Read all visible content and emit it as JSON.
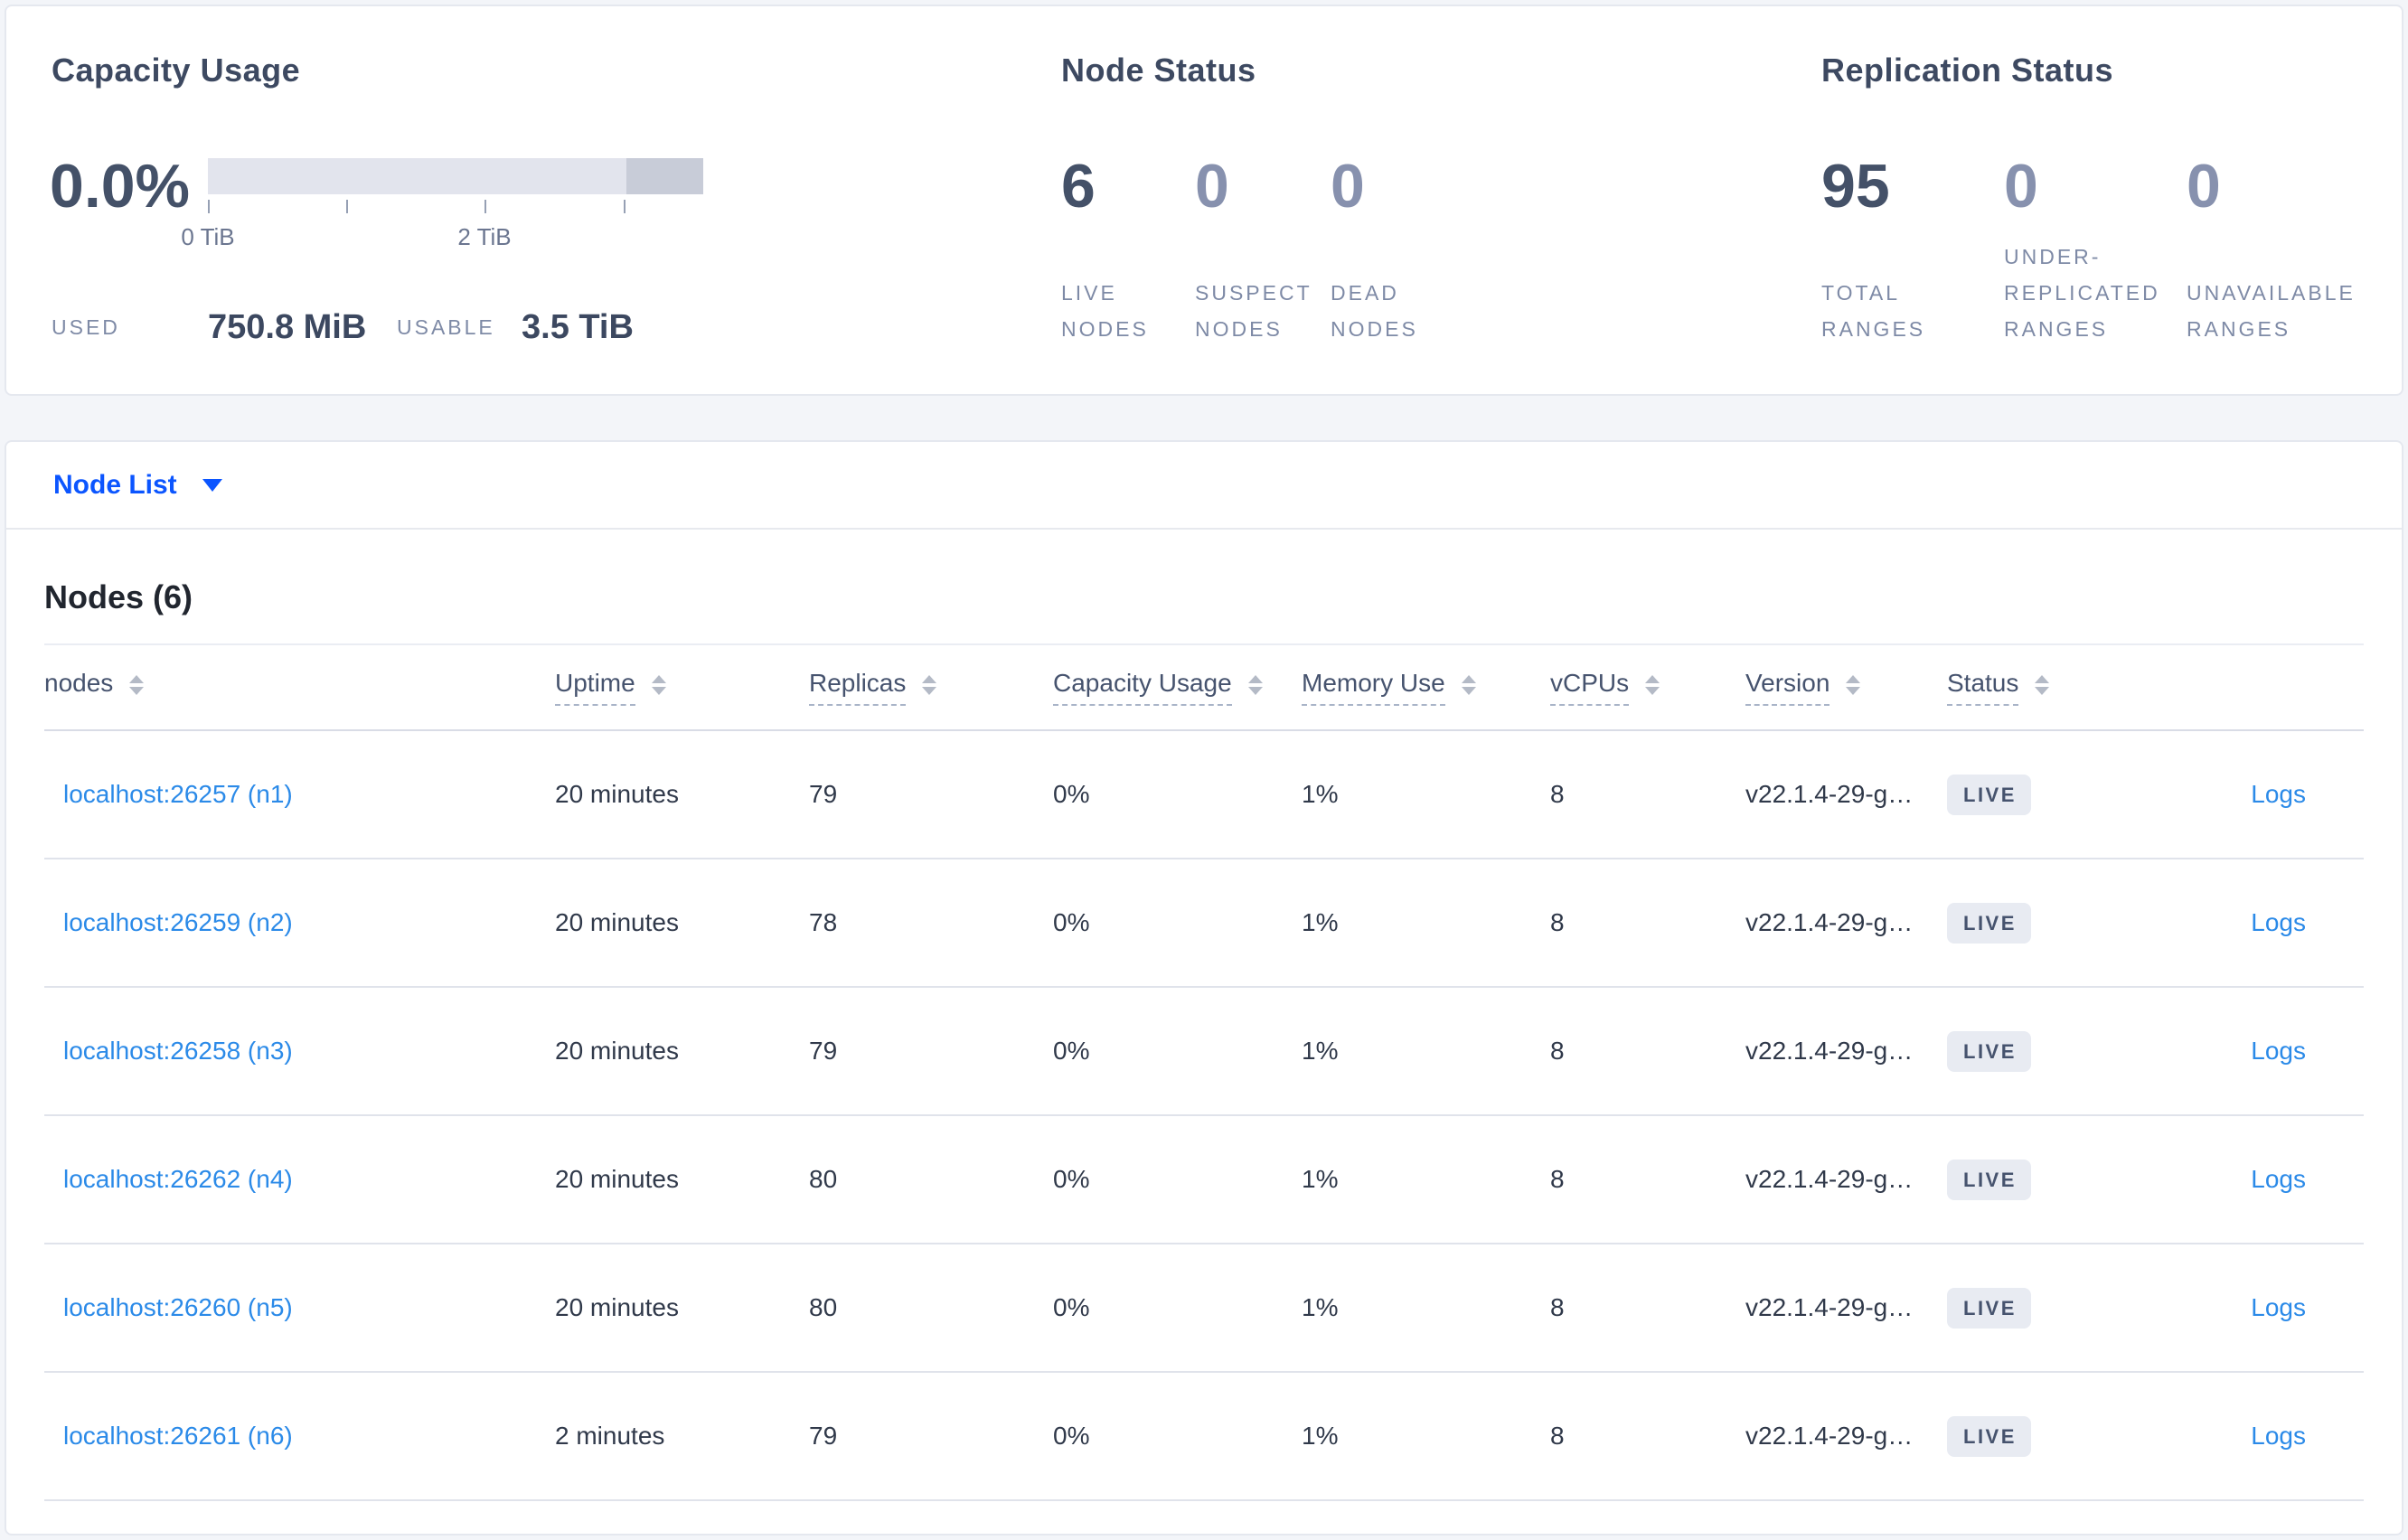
{
  "colors": {
    "accent_blue": "#0b55ff",
    "link_blue": "#2b8ae8",
    "dark_value": "#445168",
    "muted_value": "#8791ae",
    "label_gray": "#7e8aa6",
    "badge_bg": "#e8ebf2",
    "bar_light": "#e2e4ed",
    "bar_dark": "#c8ccd8"
  },
  "capacity_usage": {
    "title": "Capacity Usage",
    "percent_used": "0.0%",
    "axis": {
      "tick_labels": [
        "0 TiB",
        "2 TiB"
      ],
      "tick_count": 4
    },
    "used": {
      "label": "USED",
      "value": "750.8 MiB"
    },
    "usable": {
      "label": "USABLE",
      "value": "3.5 TiB"
    }
  },
  "node_status": {
    "title": "Node Status",
    "stats": [
      {
        "value": "6",
        "label_lines": [
          "LIVE",
          "NODES"
        ],
        "emphasis": "dark"
      },
      {
        "value": "0",
        "label_lines": [
          "SUSPECT",
          "NODES"
        ],
        "emphasis": "light"
      },
      {
        "value": "0",
        "label_lines": [
          "DEAD",
          "NODES"
        ],
        "emphasis": "light"
      }
    ]
  },
  "replication_status": {
    "title": "Replication Status",
    "stats": [
      {
        "value": "95",
        "label_lines": [
          "TOTAL",
          "RANGES"
        ],
        "emphasis": "dark"
      },
      {
        "value": "0",
        "label_lines": [
          "UNDER-",
          "REPLICATED",
          "RANGES"
        ],
        "emphasis": "light"
      },
      {
        "value": "0",
        "label_lines": [
          "UNAVAILABLE",
          "RANGES"
        ],
        "emphasis": "light"
      }
    ]
  },
  "node_list": {
    "selector_label": "Node List"
  },
  "nodes_table": {
    "heading": "Nodes (6)",
    "columns": [
      {
        "label": "nodes",
        "sortable": true,
        "underlined": false
      },
      {
        "label": "Uptime",
        "sortable": true,
        "underlined": true
      },
      {
        "label": "Replicas",
        "sortable": true,
        "underlined": true
      },
      {
        "label": "Capacity Usage",
        "sortable": true,
        "underlined": true
      },
      {
        "label": "Memory Use",
        "sortable": true,
        "underlined": true
      },
      {
        "label": "vCPUs",
        "sortable": true,
        "underlined": true
      },
      {
        "label": "Version",
        "sortable": true,
        "underlined": true
      },
      {
        "label": "Status",
        "sortable": true,
        "underlined": true
      },
      {
        "label": "",
        "sortable": false,
        "underlined": false
      }
    ],
    "rows": [
      {
        "node": "localhost:26257 (n1)",
        "uptime": "20 minutes",
        "replicas": "79",
        "capacity_usage": "0%",
        "memory_use": "1%",
        "vcpus": "8",
        "version": "v22.1.4-29-g…",
        "status": "LIVE",
        "logs_label": "Logs"
      },
      {
        "node": "localhost:26259 (n2)",
        "uptime": "20 minutes",
        "replicas": "78",
        "capacity_usage": "0%",
        "memory_use": "1%",
        "vcpus": "8",
        "version": "v22.1.4-29-g…",
        "status": "LIVE",
        "logs_label": "Logs"
      },
      {
        "node": "localhost:26258 (n3)",
        "uptime": "20 minutes",
        "replicas": "79",
        "capacity_usage": "0%",
        "memory_use": "1%",
        "vcpus": "8",
        "version": "v22.1.4-29-g…",
        "status": "LIVE",
        "logs_label": "Logs"
      },
      {
        "node": "localhost:26262 (n4)",
        "uptime": "20 minutes",
        "replicas": "80",
        "capacity_usage": "0%",
        "memory_use": "1%",
        "vcpus": "8",
        "version": "v22.1.4-29-g…",
        "status": "LIVE",
        "logs_label": "Logs"
      },
      {
        "node": "localhost:26260 (n5)",
        "uptime": "20 minutes",
        "replicas": "80",
        "capacity_usage": "0%",
        "memory_use": "1%",
        "vcpus": "8",
        "version": "v22.1.4-29-g…",
        "status": "LIVE",
        "logs_label": "Logs"
      },
      {
        "node": "localhost:26261 (n6)",
        "uptime": "2 minutes",
        "replicas": "79",
        "capacity_usage": "0%",
        "memory_use": "1%",
        "vcpus": "8",
        "version": "v22.1.4-29-g…",
        "status": "LIVE",
        "logs_label": "Logs"
      }
    ]
  }
}
